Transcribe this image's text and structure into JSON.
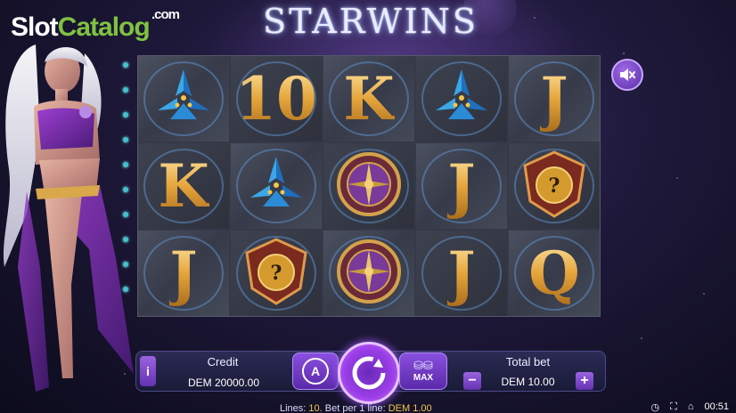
{
  "watermark": {
    "slot": "Slot",
    "catalog": "Catalog",
    "com": ".com"
  },
  "game": {
    "title": "STARWINS"
  },
  "reels": {
    "rows": [
      [
        "pyramid-symbol",
        "10",
        "K",
        "pyramid-symbol",
        "J"
      ],
      [
        "K",
        "pyramid-symbol",
        "compass-symbol",
        "J",
        "mystery-symbol"
      ],
      [
        "J",
        "mystery-symbol",
        "compass-symbol",
        "J",
        "Q"
      ]
    ]
  },
  "controls": {
    "sound_icon": "speaker-muted-icon",
    "info_label": "i",
    "credit_label": "Credit",
    "credit_value": "DEM 20000.00",
    "auto_label": "A",
    "spin_icon": "spin-icon",
    "max_label": "MAX",
    "total_bet_label": "Total bet",
    "total_bet_value": "DEM 10.00",
    "minus_label": "−",
    "plus_label": "+"
  },
  "status": {
    "lines_label": "Lines:",
    "lines_value": "10.",
    "bet_label": "Bet per 1 line:",
    "bet_value": "DEM 1.00",
    "time": "00:51"
  },
  "colors": {
    "accent": "#9b3ee8",
    "gold": "#e5a53b",
    "highlight": "#f2c84b",
    "watermark_green": "#7fc241"
  }
}
